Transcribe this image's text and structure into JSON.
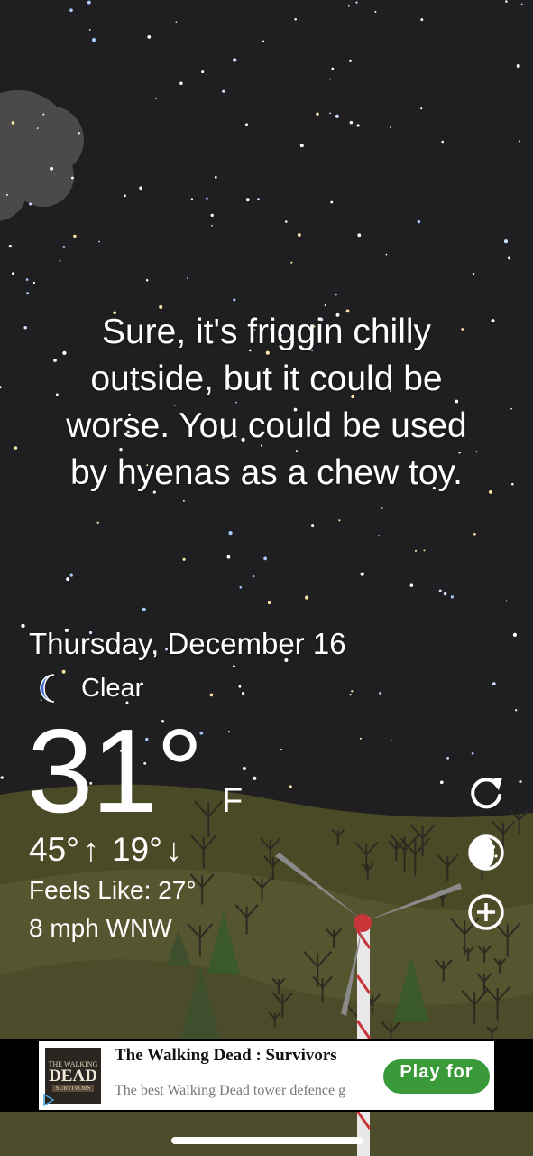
{
  "quote": {
    "lines": [
      "Sure, it's friggin chilly",
      "outside, but it could be",
      "worse. You could be used",
      "by hyenas as a chew toy."
    ]
  },
  "weather": {
    "date": "Thursday, December 16",
    "condition": "Clear",
    "condition_icon": "crescent-moon-icon",
    "temperature": "31°",
    "unit": "F",
    "high": "45°",
    "low": "19°",
    "feels_like": "Feels Like: 27°",
    "wind": "8 mph WNW"
  },
  "side_buttons": [
    {
      "name": "refresh",
      "icon": "refresh-icon"
    },
    {
      "name": "moon-phase",
      "icon": "moon-phase-icon"
    },
    {
      "name": "add-location",
      "icon": "add-circle-icon"
    }
  ],
  "ad": {
    "logo_line1": "THE WALKING",
    "logo_line2": "DEAD",
    "logo_line3": "SURVIVORS",
    "title": "The Walking Dead : Survivors",
    "description": "The best Walking Dead tower defence g",
    "cta": "Play for"
  },
  "colors": {
    "sky": "#1f1f21",
    "hill": "#5a5a2e",
    "moon_icon": "#3f6fd4",
    "ad_button": "#3a9a3a"
  }
}
